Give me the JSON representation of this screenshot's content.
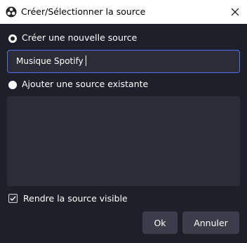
{
  "window": {
    "title": "Créer/Sélectionner la source",
    "app_icon": "obs-logo-icon",
    "close_icon": "close-icon"
  },
  "create_new": {
    "label": "Créer une nouvelle source",
    "selected": true,
    "name_value": "Musique Spotify"
  },
  "add_existing": {
    "label": "Ajouter une source existante",
    "selected": false,
    "items": []
  },
  "visible_checkbox": {
    "label": "Rendre la source visible",
    "checked": true
  },
  "buttons": {
    "ok_label": "Ok",
    "cancel_label": "Annuler"
  },
  "colors": {
    "background": "#1e1f29",
    "field_background": "#2a2c38",
    "focus_border": "#4f6df0",
    "button_background": "#3b3d4a"
  }
}
